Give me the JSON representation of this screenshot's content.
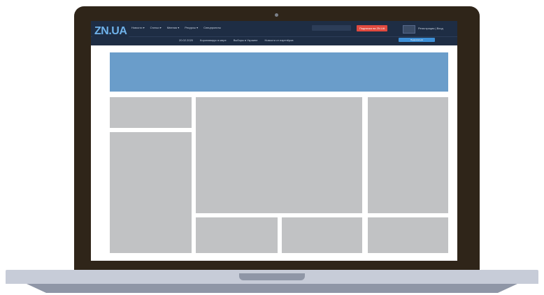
{
  "site": {
    "logo_text": "ZN.UA",
    "nav": [
      "Новости ▾",
      "Статьи ▾",
      "Мнения ▾",
      "Ресурсы ▾",
      "Спецпроекты"
    ],
    "red_button": "Подписка на ZN.UA",
    "user_link": "Регистрация | Вход",
    "subnav": [
      "20.02.2020",
      "Коронавирус в мире",
      "Выборы в Украине",
      "Новости от партнёров"
    ],
    "blue_button": "Подписаться"
  },
  "colors": {
    "laptop_frame": "#2f2519",
    "header": "#1e2d44",
    "banner": "#6a9dca",
    "placeholder": "#c1c2c4",
    "accent_red": "#e04a3f",
    "accent_blue": "#3d8fd6"
  }
}
